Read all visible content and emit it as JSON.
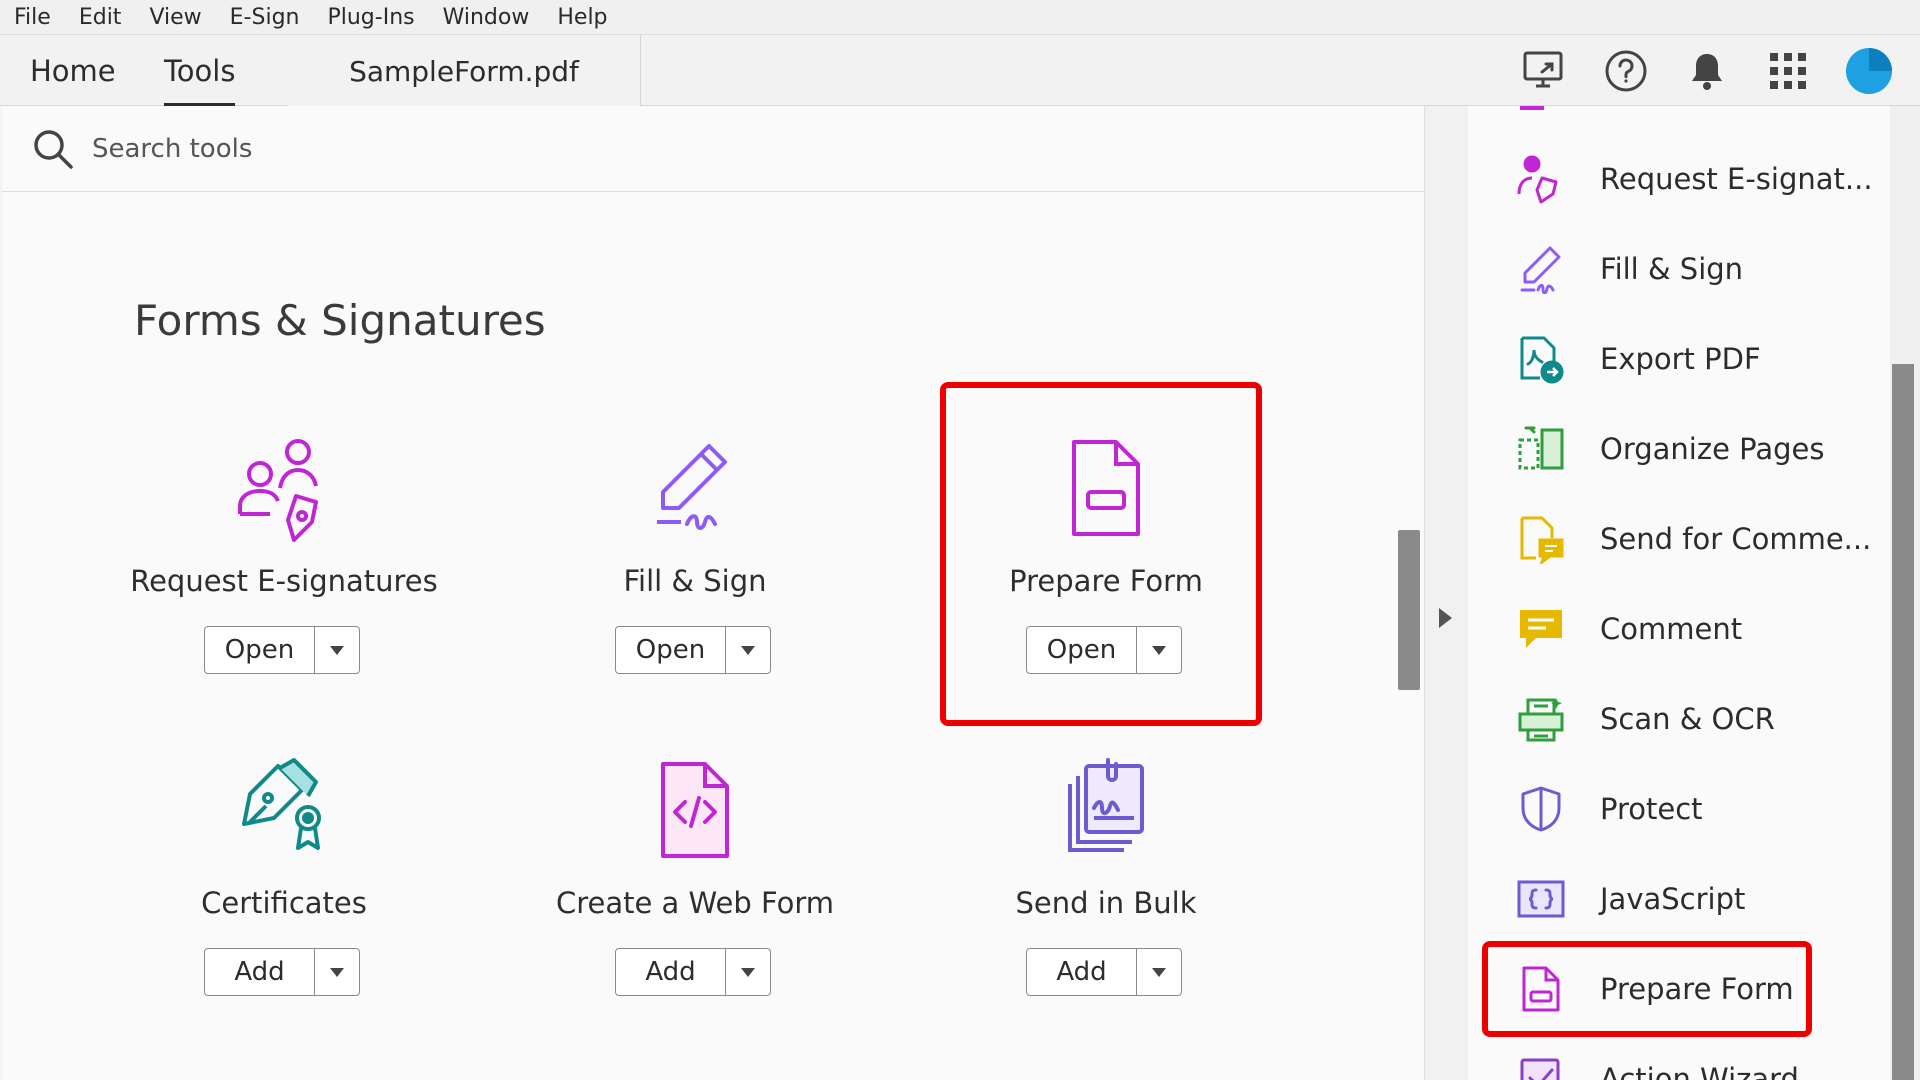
{
  "menu": [
    "File",
    "Edit",
    "View",
    "E-Sign",
    "Plug-Ins",
    "Window",
    "Help"
  ],
  "tabs": {
    "home": "Home",
    "tools": "Tools",
    "document": "SampleForm.pdf"
  },
  "search": {
    "placeholder": "Search tools"
  },
  "section": {
    "title": "Forms & Signatures"
  },
  "tools": [
    {
      "name": "Request E-signatures",
      "action": "Open",
      "icon": "request-esignatures-icon"
    },
    {
      "name": "Fill & Sign",
      "action": "Open",
      "icon": "fill-sign-icon"
    },
    {
      "name": "Prepare Form",
      "action": "Open",
      "icon": "prepare-form-icon"
    },
    {
      "name": "Certificates",
      "action": "Add",
      "icon": "certificates-icon"
    },
    {
      "name": "Create a Web Form",
      "action": "Add",
      "icon": "web-form-icon"
    },
    {
      "name": "Send in Bulk",
      "action": "Add",
      "icon": "send-bulk-icon"
    }
  ],
  "right_panel": [
    {
      "label": "Request E-signat...",
      "icon": "request-esignatures-icon"
    },
    {
      "label": "Fill & Sign",
      "icon": "fill-sign-icon"
    },
    {
      "label": "Export PDF",
      "icon": "export-pdf-icon"
    },
    {
      "label": "Organize Pages",
      "icon": "organize-pages-icon"
    },
    {
      "label": "Send for Comme...",
      "icon": "send-for-comment-icon"
    },
    {
      "label": "Comment",
      "icon": "comment-icon"
    },
    {
      "label": "Scan & OCR",
      "icon": "scan-ocr-icon"
    },
    {
      "label": "Protect",
      "icon": "protect-icon"
    },
    {
      "label": "JavaScript",
      "icon": "javascript-icon"
    },
    {
      "label": "Prepare Form",
      "icon": "prepare-form-icon"
    },
    {
      "label": "Action Wizard",
      "icon": "action-wizard-icon"
    }
  ],
  "colors": {
    "highlight": "#ef0000",
    "magenta": "#c026d3",
    "purple": "#7c3aed",
    "teal": "#0e8a8a",
    "yellow": "#e6b800",
    "green": "#2e9e3e",
    "avatar": "#1da1e0"
  }
}
